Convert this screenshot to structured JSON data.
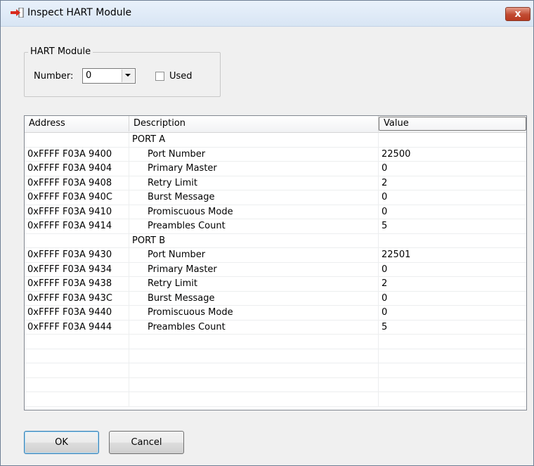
{
  "window": {
    "title": "Inspect HART Module",
    "close_label": "x"
  },
  "group": {
    "legend": "HART Module",
    "number_label": "Number:",
    "number_value": "0",
    "used_label": "Used",
    "used_checked": false
  },
  "table": {
    "columns": [
      "Address",
      "Description",
      "Value"
    ],
    "rows": [
      {
        "address": "",
        "description": "PORT A",
        "value": "",
        "indent": false
      },
      {
        "address": "0xFFFF F03A 9400",
        "description": "Port Number",
        "value": "22500",
        "indent": true
      },
      {
        "address": "0xFFFF F03A 9404",
        "description": "Primary Master",
        "value": "0",
        "indent": true
      },
      {
        "address": "0xFFFF F03A 9408",
        "description": "Retry Limit",
        "value": "2",
        "indent": true
      },
      {
        "address": "0xFFFF F03A 940C",
        "description": "Burst Message",
        "value": "0",
        "indent": true
      },
      {
        "address": "0xFFFF F03A 9410",
        "description": "Promiscuous Mode",
        "value": "0",
        "indent": true
      },
      {
        "address": "0xFFFF F03A 9414",
        "description": "Preambles Count",
        "value": "5",
        "indent": true
      },
      {
        "address": "",
        "description": "PORT B",
        "value": "",
        "indent": false
      },
      {
        "address": "0xFFFF F03A 9430",
        "description": "Port Number",
        "value": "22501",
        "indent": true
      },
      {
        "address": "0xFFFF F03A 9434",
        "description": "Primary Master",
        "value": "0",
        "indent": true
      },
      {
        "address": "0xFFFF F03A 9438",
        "description": "Retry Limit",
        "value": "2",
        "indent": true
      },
      {
        "address": "0xFFFF F03A 943C",
        "description": "Burst Message",
        "value": "0",
        "indent": true
      },
      {
        "address": "0xFFFF F03A 9440",
        "description": "Promiscuous Mode",
        "value": "0",
        "indent": true
      },
      {
        "address": "0xFFFF F03A 9444",
        "description": "Preambles Count",
        "value": "5",
        "indent": true
      },
      {
        "address": "",
        "description": "",
        "value": "",
        "indent": false
      },
      {
        "address": "",
        "description": "",
        "value": "",
        "indent": false
      },
      {
        "address": "",
        "description": "",
        "value": "",
        "indent": false
      },
      {
        "address": "",
        "description": "",
        "value": "",
        "indent": false
      },
      {
        "address": "",
        "description": "",
        "value": "",
        "indent": false
      }
    ]
  },
  "buttons": {
    "ok": "OK",
    "cancel": "Cancel"
  },
  "colors": {
    "close_button": "#c14a31",
    "titlebar": "#dce7f5",
    "window_bg": "#f0f0f0"
  }
}
